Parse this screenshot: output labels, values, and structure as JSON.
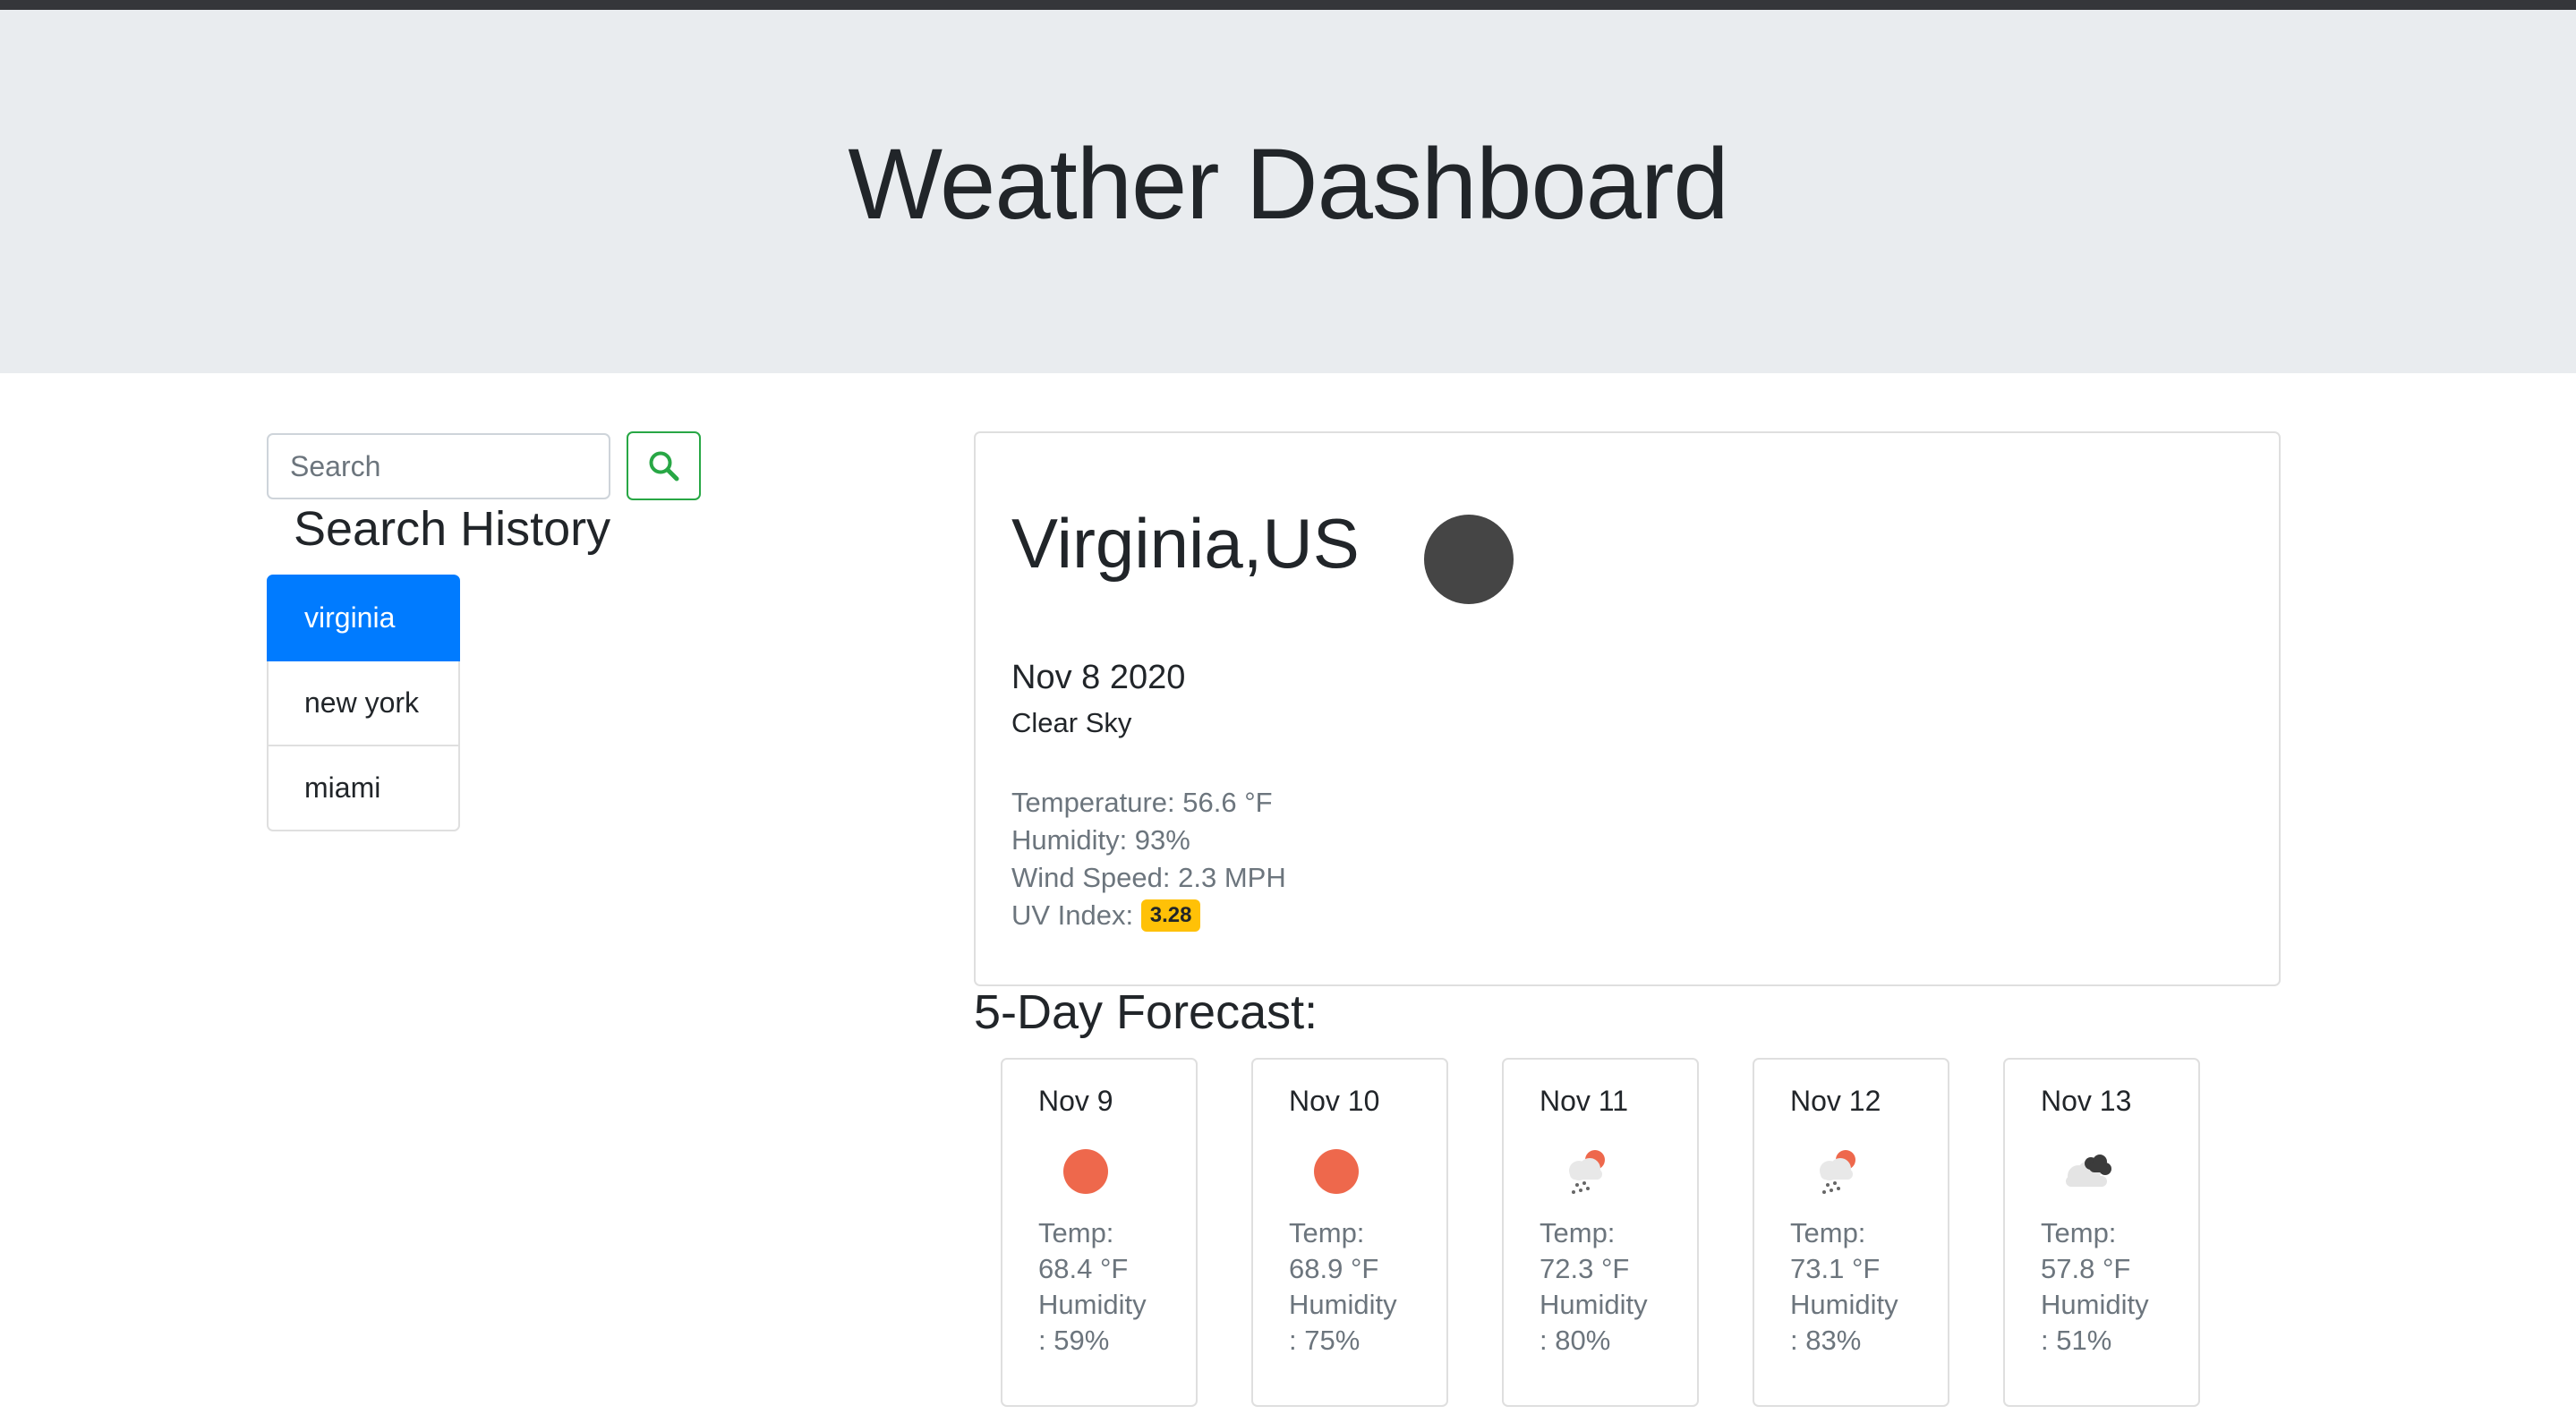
{
  "header": {
    "title": "Weather Dashboard"
  },
  "search": {
    "placeholder": "Search",
    "value": ""
  },
  "history": {
    "title": "Search History",
    "items": [
      {
        "label": "virginia",
        "active": true
      },
      {
        "label": "new york",
        "active": false
      },
      {
        "label": "miami",
        "active": false
      }
    ]
  },
  "current": {
    "city": "Virginia,US",
    "date": "Nov 8 2020",
    "description": "Clear Sky",
    "temperature": "Temperature: 56.6 °F",
    "humidity": "Humidity: 93%",
    "wind": "Wind Speed: 2.3 MPH",
    "uv_label": "UV Index:",
    "uv_value": "3.28",
    "icon": "clear-sky-icon",
    "uv_color": "#ffc107"
  },
  "forecast": {
    "title": "5-Day Forecast:",
    "days": [
      {
        "date": "Nov 9",
        "icon": "sun-icon",
        "temp_label": "Temp:",
        "temp": "68.4 °F",
        "humidity_label": "Humidity",
        "humidity": ": 59%"
      },
      {
        "date": "Nov 10",
        "icon": "sun-icon",
        "temp_label": "Temp:",
        "temp": "68.9 °F",
        "humidity_label": "Humidity",
        "humidity": ": 75%"
      },
      {
        "date": "Nov 11",
        "icon": "rain-sun-icon",
        "temp_label": "Temp:",
        "temp": "72.3 °F",
        "humidity_label": "Humidity",
        "humidity": ": 80%"
      },
      {
        "date": "Nov 12",
        "icon": "rain-sun-icon",
        "temp_label": "Temp:",
        "temp": "73.1 °F",
        "humidity_label": "Humidity",
        "humidity": ": 83%"
      },
      {
        "date": "Nov 13",
        "icon": "cloudy-icon",
        "temp_label": "Temp:",
        "temp": "57.8 °F",
        "humidity_label": "Humidity",
        "humidity": ": 51%"
      }
    ]
  },
  "colors": {
    "active_blue": "#007bff",
    "search_green": "#28a745",
    "sun_orange": "#ee684c",
    "header_bg": "#e9ecef"
  }
}
